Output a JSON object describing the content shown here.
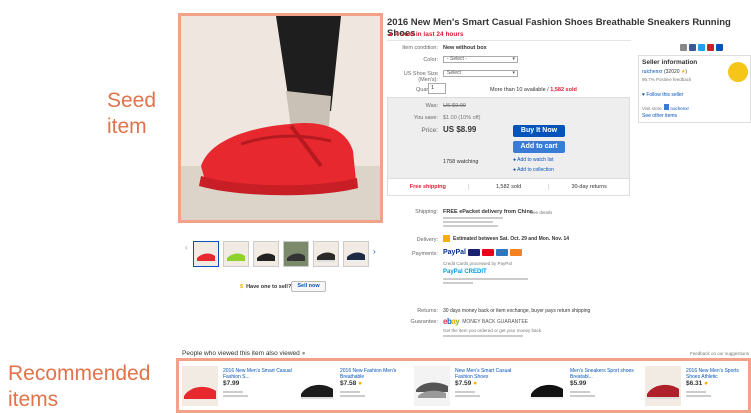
{
  "annotations": {
    "seed": [
      "Seed",
      "item"
    ],
    "recommended": [
      "Recommended",
      "items"
    ]
  },
  "listing": {
    "title": "2016 New Men's Smart Casual Fashion Shoes Breathable Sneakers Running Shoes",
    "sold_notice": "4 sold in last 24 hours",
    "condition_label": "Item condition:",
    "condition_value": "New without box",
    "color_label": "Color:",
    "color_value": "- Select -",
    "size_label": "US Shoe Size (Men's):",
    "size_value": "Select",
    "quantity_label": "Quantity:",
    "quantity_value": "1",
    "availability": "More than 10 available",
    "sold_count_inline": "1,582 sold"
  },
  "pricing": {
    "was_label": "Was:",
    "was_value": "US $9.99",
    "save_label": "You save:",
    "save_value": "$1.00 (10% off)",
    "price_label": "Price:",
    "price_value": "US $8.99",
    "buy_label": "Buy It Now",
    "cart_label": "Add to cart",
    "watching": "1758 watching",
    "watch_link": "Add to watch list",
    "collection_link": "Add to collection",
    "free_shipping": "Free shipping",
    "sold_total": "1,582 sold",
    "returns": "30-day returns"
  },
  "details": {
    "shipping_label": "Shipping:",
    "shipping_value": "FREE ePacket delivery from China",
    "shipping_sub": "See details",
    "delivery_label": "Delivery:",
    "delivery_value": "Estimated between Sat. Oct. 29 and Mon. Nov. 14",
    "payments_label": "Payments:",
    "payments_sub": "Credit Cards processed by PayPal",
    "paypal_credit": "PayPal CREDIT",
    "returns_label": "Returns:",
    "returns_value": "30 days money back or item exchange, buyer pays return shipping",
    "guarantee_label": "Guarantee:",
    "guarantee_value": "MONEY BACK GUARANTEE",
    "guarantee_sub": "Get the item you ordered or get your money back."
  },
  "seller": {
    "heading": "Seller information",
    "name": "ruichenxr",
    "score": "(32020",
    "feedback": "96.7% Positive feedback",
    "follow": "Follow this seller",
    "visit_label": "Visit store:",
    "store": "ruichenxr",
    "see_items": "See other items"
  },
  "sell_now": {
    "prompt": "Have one to sell?",
    "button": "Sell now"
  },
  "recommended": {
    "heading": "People who viewed this item also viewed",
    "feedback_link": "Feedback on our suggestions",
    "items": [
      {
        "title": "2016 New Men's Smart Casual Fashion S...",
        "price": "$7.99"
      },
      {
        "title": "2016 New Fashion Men's Breathable",
        "price": "$7.58"
      },
      {
        "title": "New Men's Smart Casual Fashion Shoes",
        "price": "$7.59"
      },
      {
        "title": "Men's Sneakers Sport shoes Breatabl...",
        "price": "$5.99"
      },
      {
        "title": "2016 New Men's Sports Shoes Athletic",
        "price": "$6.31"
      }
    ],
    "sponsored": "SPONSORED"
  },
  "colors": {
    "accent_frame": "#f2a288",
    "ebay_blue": "#0654ba",
    "shoe_red": "#e8282f",
    "sold_red": "#dd1e31"
  }
}
